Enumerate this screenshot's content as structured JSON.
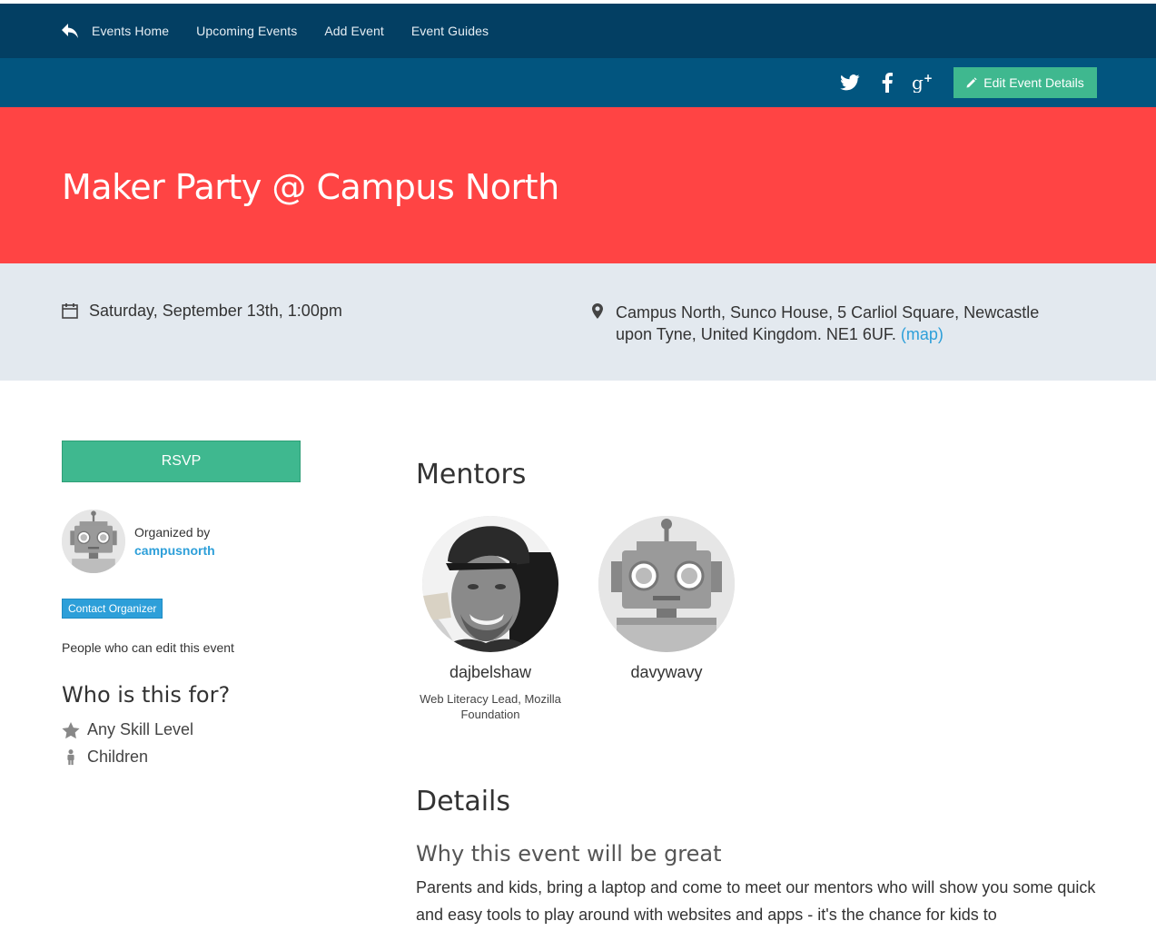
{
  "nav": {
    "items": [
      {
        "label": "Events Home"
      },
      {
        "label": "Upcoming Events"
      },
      {
        "label": "Add Event"
      },
      {
        "label": "Event Guides"
      }
    ]
  },
  "toolbar": {
    "social": [
      "twitter-icon",
      "facebook-icon",
      "google-plus-icon"
    ],
    "edit_label": "Edit Event Details"
  },
  "event": {
    "title": "Maker Party @ Campus North",
    "date": "Saturday, September 13th, 1:00pm",
    "location": "Campus North, Sunco House, 5 Carliol Square, Newcastle upon Tyne, United Kingdom. NE1 6UF.",
    "map_label": "(map)"
  },
  "sidebar": {
    "rsvp_label": "RSVP",
    "organized_by": "Organized by",
    "organizer": "campusnorth",
    "contact_label": "Contact Organizer",
    "editors_label": "People who can edit this event",
    "who_title": "Who is this for?",
    "audience": [
      "Any Skill Level",
      "Children"
    ]
  },
  "main": {
    "mentors_title": "Mentors",
    "mentors": [
      {
        "name": "dajbelshaw",
        "title": "Web Literacy Lead, Mozilla Foundation"
      },
      {
        "name": "davywavy",
        "title": ""
      }
    ],
    "details_title": "Details",
    "subtitle": "Why this event will be great",
    "description": "Parents and kids, bring a laptop and come to meet our mentors who will show you some quick and easy tools to play around with websites and apps - it's the chance for kids to"
  },
  "colors": {
    "nav_bg": "#033f63",
    "subnav_bg": "#02557f",
    "hero_bg": "#ff4444",
    "info_bg": "#e3e9ef",
    "accent_green": "#3fb88f",
    "link_blue": "#2d9fd9"
  }
}
